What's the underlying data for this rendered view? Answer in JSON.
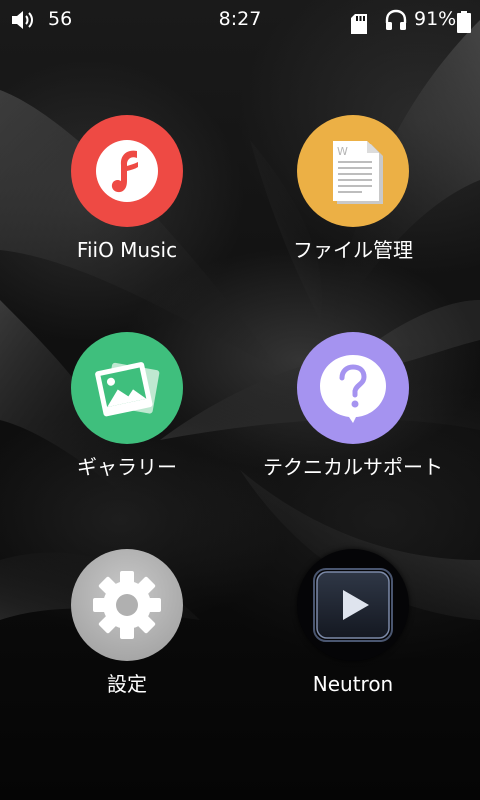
{
  "status_bar": {
    "volume_icon": "speaker-volume-icon",
    "volume": "56",
    "time": "8:27",
    "sd_icon": "sd-card-icon",
    "headphone_icon": "headphone-icon",
    "battery": "91%",
    "battery_icon": "battery-icon"
  },
  "apps": [
    {
      "label": "FiiO Music",
      "icon": "fiio-music-icon",
      "color": "#ee4a44"
    },
    {
      "label": "ファイル管理",
      "icon": "file-document-icon",
      "color": "#ecb045"
    },
    {
      "label": "ギャラリー",
      "icon": "gallery-photo-icon",
      "color": "#3fbf7d"
    },
    {
      "label": "テクニカルサポート",
      "icon": "question-bubble-icon",
      "color": "#a593f0"
    },
    {
      "label": "設定",
      "icon": "gear-icon",
      "color": "#b3b3b3"
    },
    {
      "label": "Neutron",
      "icon": "play-icon",
      "color": "#050507"
    }
  ]
}
